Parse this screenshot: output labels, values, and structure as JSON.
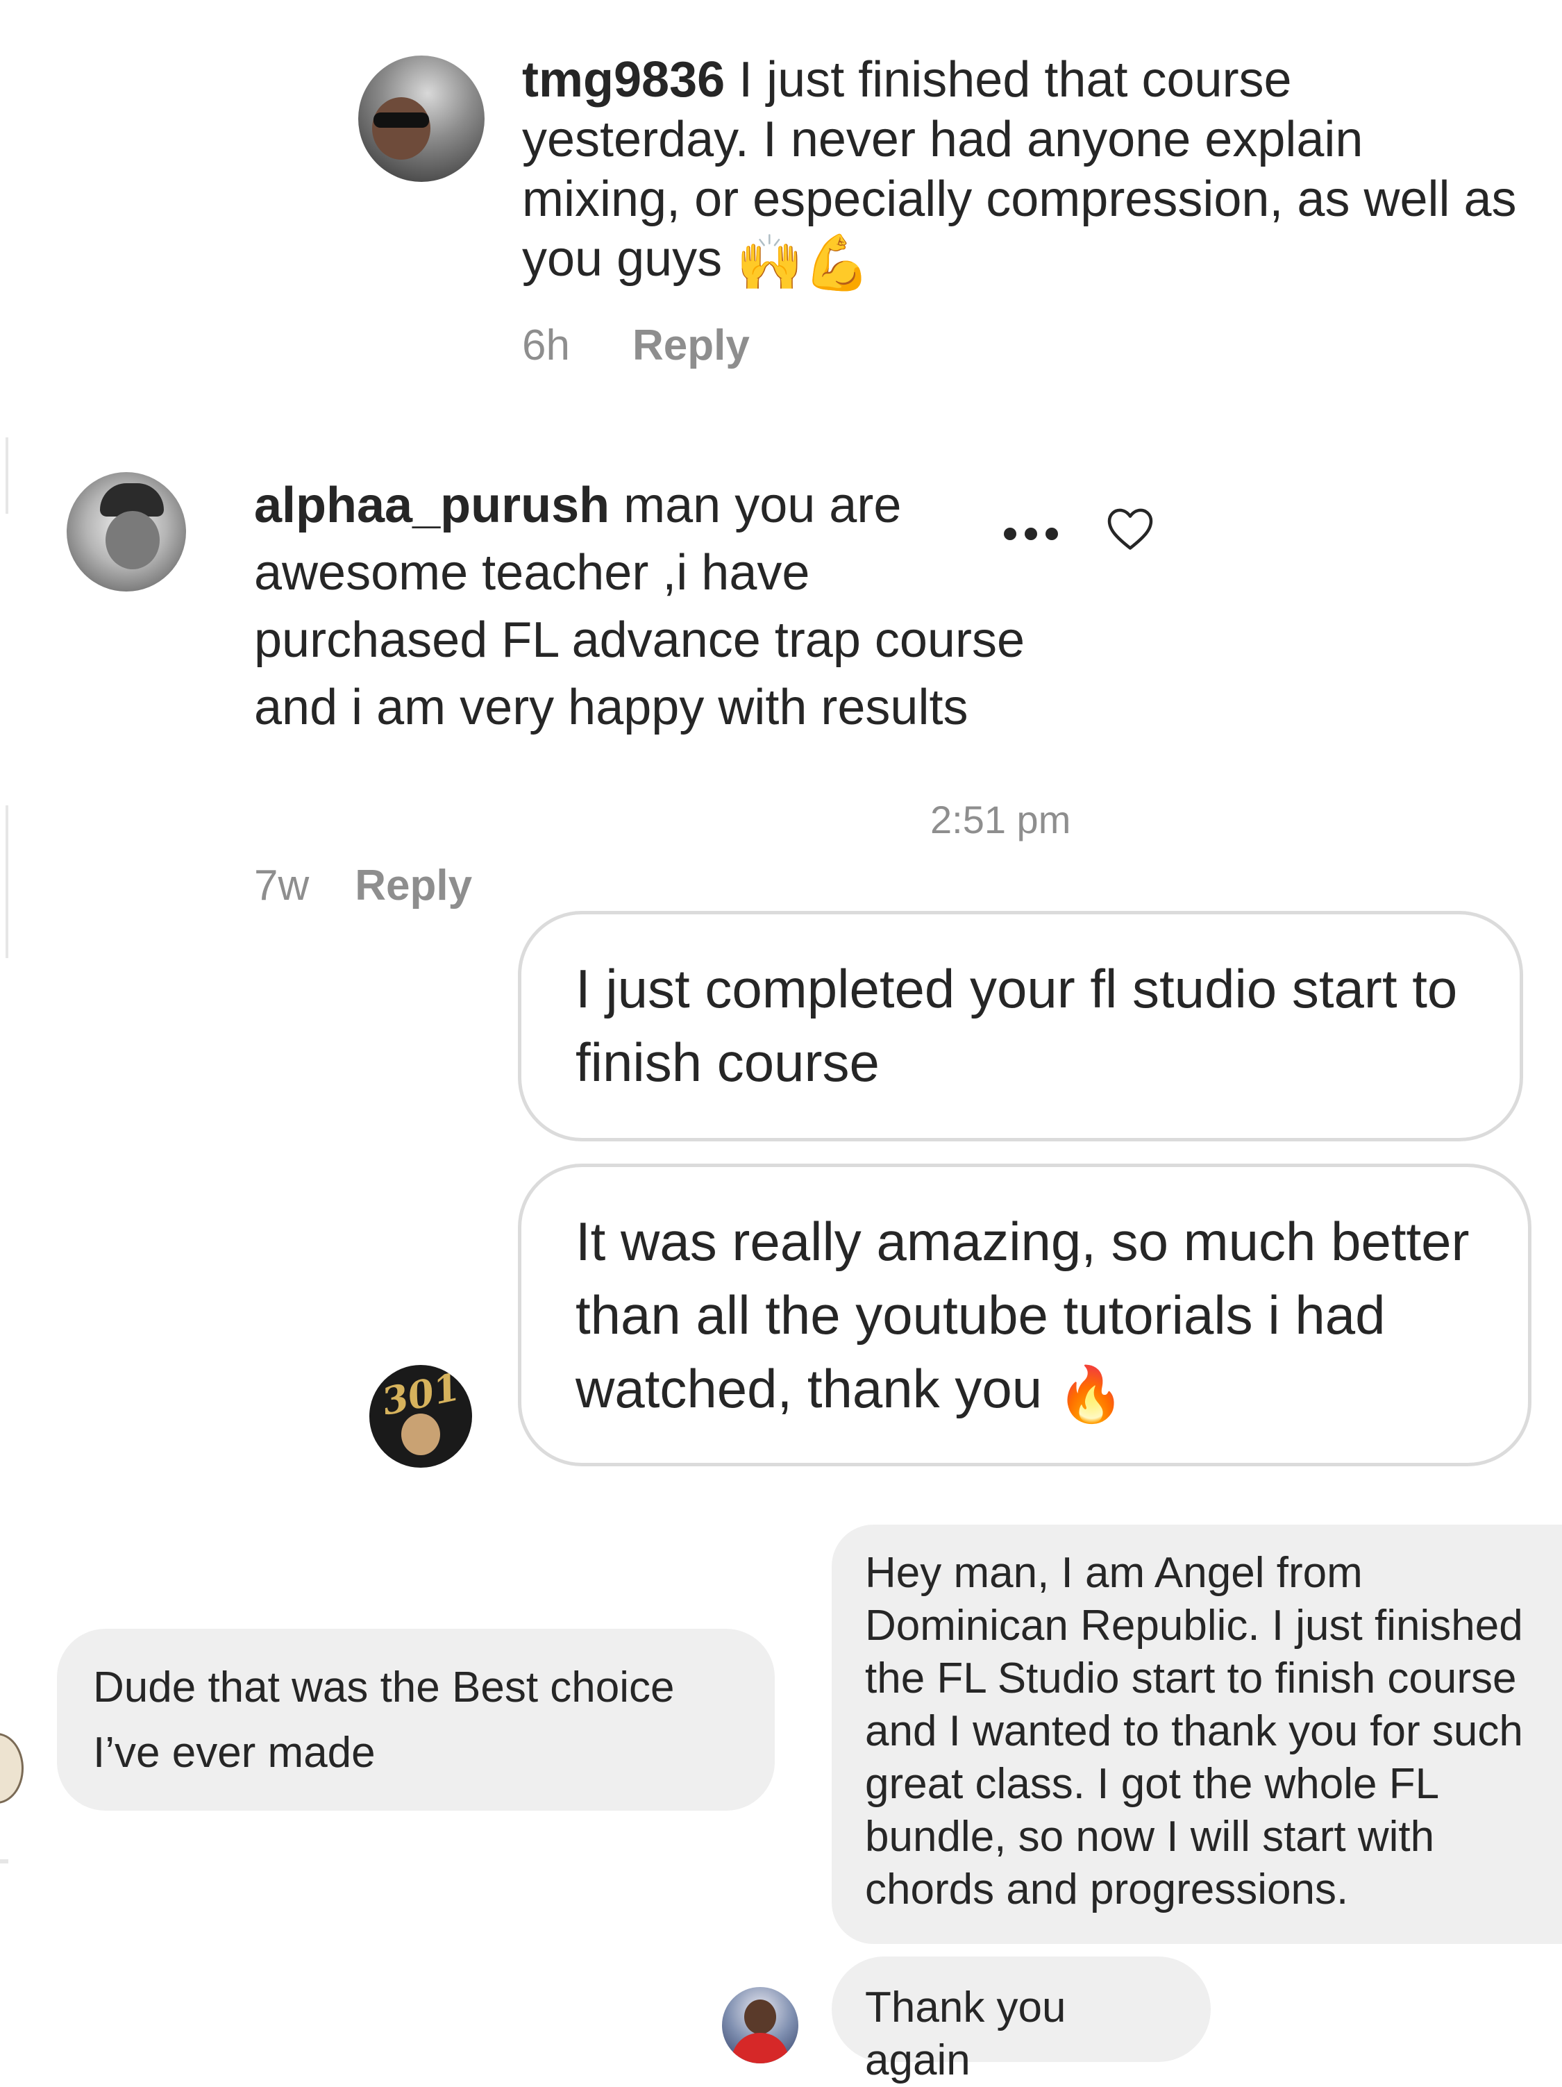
{
  "comment1": {
    "username": "tmg9836",
    "text": "I just finished that course yesterday. I never had anyone explain mixing, or especially compression, as well as you guys",
    "emojis": "🙌💪",
    "time": "6h",
    "reply": "Reply"
  },
  "comment2": {
    "username": "alphaa_purush",
    "text": "man you are awesome teacher ,i have purchased FL advance trap course and i am very happy with results",
    "time": "7w",
    "reply": "Reply",
    "more_icon": "ellipsis-icon",
    "like_icon": "heart-outline-icon"
  },
  "dm1": {
    "timestamp": "2:51 pm",
    "message1": "I just completed your fl studio start to finish course",
    "message2": "It was really amazing, so much better than all the youtube tutorials i had watched, thank you",
    "message2_emoji": "🔥",
    "avatar_text": "301"
  },
  "dm2": {
    "message": "Dude that was the Best choice I’ve ever made"
  },
  "dm3": {
    "message1": "Hey man, I am Angel from Dominican Republic. I just finished the FL Studio start to finish course and I wanted to thank you for such great class. I got the whole FL bundle, so now I will start with chords and progressions.",
    "message2": "Thank you again"
  }
}
